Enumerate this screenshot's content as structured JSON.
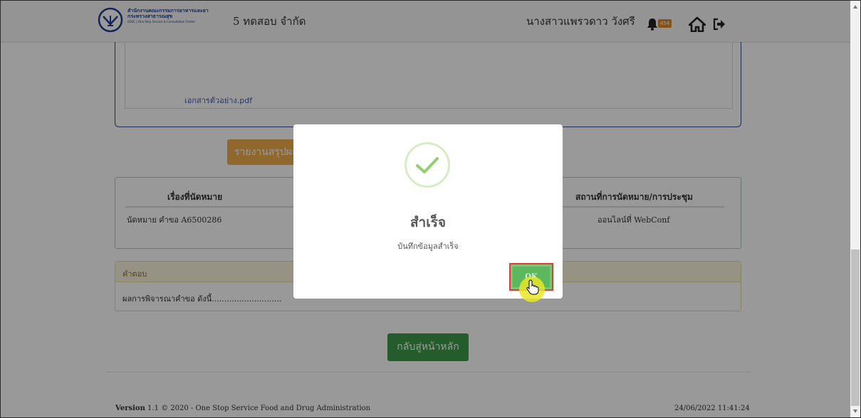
{
  "header": {
    "logo_line1": "สำนักงานคณะกรรมการอาหารและยา",
    "logo_line2": "กระทรวงสาธารณสุข",
    "logo_line3": "OSSC | One Stop Service & Consultation Center",
    "company": "5 ทดสอบ จำกัด",
    "username": "นางสาวแพรวดาว วังศรี",
    "notification_count": "454"
  },
  "document": {
    "file_link": "เอกสารตัวอย่าง.pdf"
  },
  "report_button": "รายงานสรุปผล",
  "appointment_table": {
    "headers": [
      "เรื่องที่นัดหมาย",
      "สถานที่การนัดหมาย/การประชุม"
    ],
    "row": [
      "นัดหมาย คำขอ A6500286",
      "ออนไลน์ที่ WebConf"
    ]
  },
  "answer": {
    "label": "คำตอบ",
    "text": "ผลการพิจารณาคำขอ ดังนี้............................"
  },
  "home_button": "กลับสู่หน้าหลัก",
  "footer": {
    "version_label": "Version",
    "version_text": "1.1 © 2020 - One Stop Service Food and Drug Administration",
    "datetime": "24/06/2022 11:41:24"
  },
  "modal": {
    "title": "สำเร็จ",
    "message": "บันทึกข้อมูลสำเร็จ",
    "ok_label": "OK",
    "icon": "success-check-icon"
  },
  "colors": {
    "report_button": "#f0ad4e",
    "home_button": "#3d9b48",
    "ok_button": "#5cb85c",
    "badge": "#e28b22",
    "check": "#8fd16f"
  }
}
